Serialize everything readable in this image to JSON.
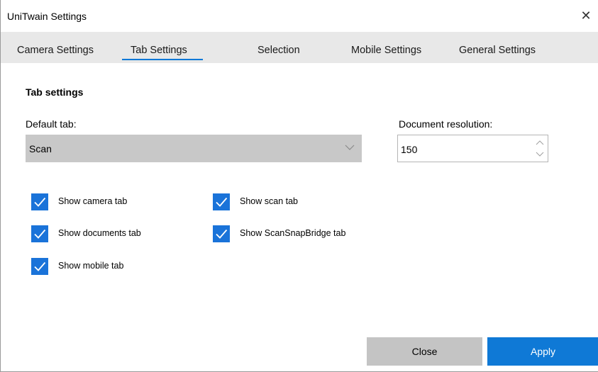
{
  "window": {
    "title": "UniTwain Settings",
    "close_glyph": "✕"
  },
  "tabs": [
    {
      "label": "Camera Settings",
      "active": false
    },
    {
      "label": "Tab Settings",
      "active": true
    },
    {
      "label": "Selection",
      "active": false
    },
    {
      "label": "Mobile Settings",
      "active": false
    },
    {
      "label": "General Settings",
      "active": false
    }
  ],
  "section": {
    "title": "Tab settings"
  },
  "default_tab": {
    "label": "Default tab:",
    "value": "Scan",
    "icon": "chevron-down-icon"
  },
  "resolution": {
    "label": "Document resolution:",
    "value": "150"
  },
  "checkboxes": [
    {
      "label": "Show camera tab",
      "checked": true
    },
    {
      "label": "Show documents tab",
      "checked": true
    },
    {
      "label": "Show mobile tab",
      "checked": true
    },
    {
      "label": "Show scan tab",
      "checked": true
    },
    {
      "label": "Show ScanSnapBridge tab",
      "checked": true
    }
  ],
  "buttons": {
    "close": "Close",
    "apply": "Apply"
  },
  "colors": {
    "accent": "#0078d7",
    "checkbox": "#1a73d9",
    "apply_button": "#0f79d6",
    "close_button": "#c4c4c4",
    "tabbar": "#e8e8e8",
    "combo": "#c8c8c8"
  }
}
